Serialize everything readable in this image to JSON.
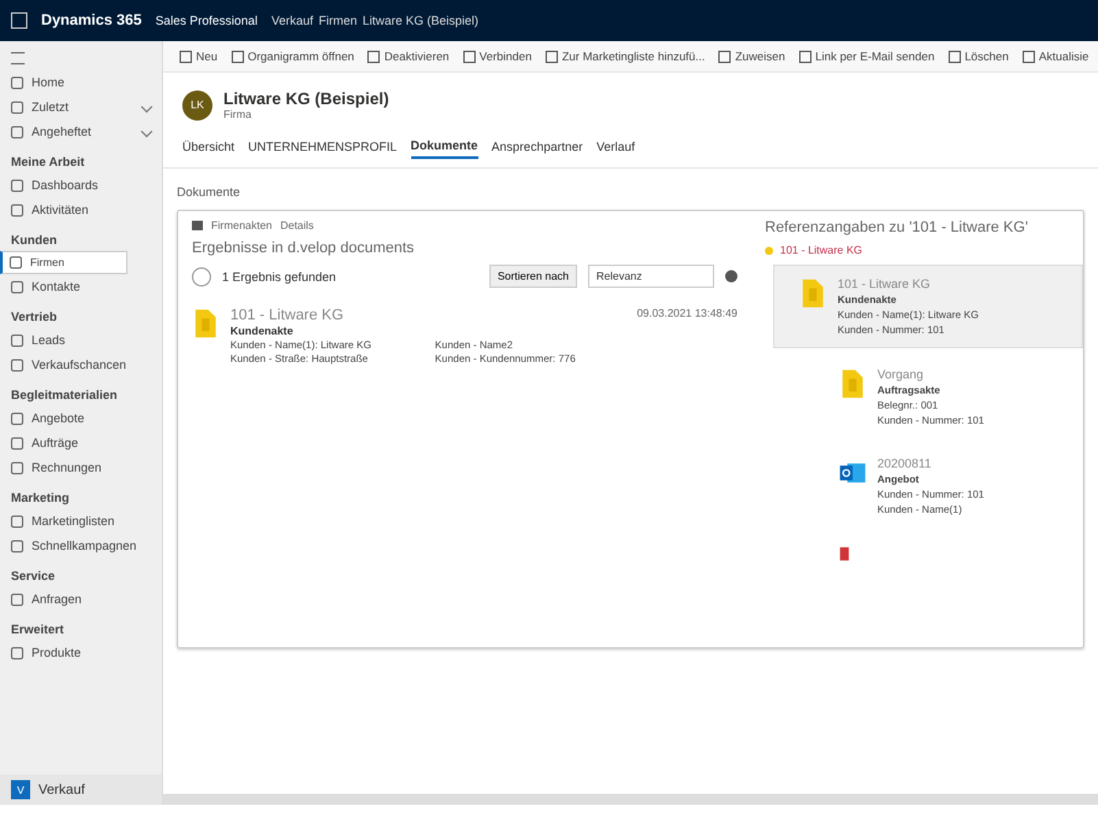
{
  "top_bar": {
    "app_name": "Dynamics 365",
    "area": "Sales Professional",
    "breadcrumb": [
      "Verkauf",
      "Firmen",
      "Litware KG (Beispiel)"
    ]
  },
  "sidebar": {
    "top_items": [
      {
        "label": "Home"
      },
      {
        "label": "Zuletzt",
        "expandable": true
      },
      {
        "label": "Angeheftet",
        "expandable": true
      }
    ],
    "groups": [
      {
        "title": "Meine Arbeit",
        "items": [
          {
            "label": "Dashboards",
            "selected": false
          },
          {
            "label": "Aktivitäten",
            "selected": false
          }
        ]
      },
      {
        "title": "Kunden",
        "items": [
          {
            "label": "Firmen",
            "selected": true
          },
          {
            "label": "Kontakte",
            "selected": false
          }
        ]
      },
      {
        "title": "Vertrieb",
        "items": [
          {
            "label": "Leads",
            "selected": false
          },
          {
            "label": "Verkaufschancen",
            "selected": false
          }
        ]
      },
      {
        "title": "Begleitmaterialien",
        "items": [
          {
            "label": "Angebote",
            "selected": false
          },
          {
            "label": "Aufträge",
            "selected": false
          },
          {
            "label": "Rechnungen",
            "selected": false
          }
        ]
      },
      {
        "title": "Marketing",
        "items": [
          {
            "label": "Marketinglisten",
            "selected": false
          },
          {
            "label": "Schnellkampagnen",
            "selected": false
          }
        ]
      },
      {
        "title": "Service",
        "items": [
          {
            "label": "Anfragen",
            "selected": false
          }
        ]
      },
      {
        "title": "Erweitert",
        "items": [
          {
            "label": "Produkte",
            "selected": false
          }
        ]
      }
    ],
    "area_switcher": {
      "badge": "V",
      "label": "Verkauf"
    }
  },
  "toolbar": [
    "Neu",
    "Organigramm öffnen",
    "Deaktivieren",
    "Verbinden",
    "Zur Marketingliste hinzufü...",
    "Zuweisen",
    "Link per E-Mail senden",
    "Löschen",
    "Aktualisie"
  ],
  "record": {
    "initials": "LK",
    "title": "Litware KG (Beispiel)",
    "subtitle": "Firma"
  },
  "tabs": [
    {
      "label": "Übersicht",
      "selected": false
    },
    {
      "label": "UNTERNEHMENSPROFIL",
      "selected": false
    },
    {
      "label": "Dokumente",
      "selected": true
    },
    {
      "label": "Ansprechpartner",
      "selected": false
    },
    {
      "label": "Verlauf",
      "selected": false
    }
  ],
  "documents": {
    "section_title": "Dokumente",
    "breadcrumb": [
      "Firmenakten",
      "Details"
    ],
    "results_title": "Ergebnisse in d.velop documents",
    "results_count": "1 Ergebnis gefunden",
    "sort_button": "Sortieren nach",
    "sort_select": "Relevanz",
    "results": [
      {
        "date": "09.03.2021 13:48:49",
        "title": "101 - Litware KG",
        "category": "Kundenakte",
        "fields": [
          "Kunden - Name(1): Litware KG",
          "Kunden - Name2",
          "Kunden - Straße: Hauptstraße",
          "Kunden - Kundennummer: 776"
        ]
      }
    ],
    "references": {
      "title": "Referenzangaben zu '101 - Litware KG'",
      "root": "101 - Litware KG",
      "items": [
        {
          "kind": "folder",
          "selected": true,
          "title": "101 - Litware KG",
          "category": "Kundenakte",
          "fields": [
            "Kunden - Name(1): Litware KG",
            "Kunden - Nummer: 101"
          ]
        },
        {
          "kind": "folder",
          "selected": false,
          "title": "Vorgang",
          "category": "Auftragsakte",
          "fields": [
            "Belegnr.: 001",
            "Kunden - Nummer: 101"
          ]
        },
        {
          "kind": "mail",
          "selected": false,
          "title": "20200811",
          "category": "Angebot",
          "fields": [
            "Kunden - Nummer: 101",
            "Kunden - Name(1)"
          ]
        },
        {
          "kind": "pdf",
          "selected": false
        }
      ]
    }
  }
}
